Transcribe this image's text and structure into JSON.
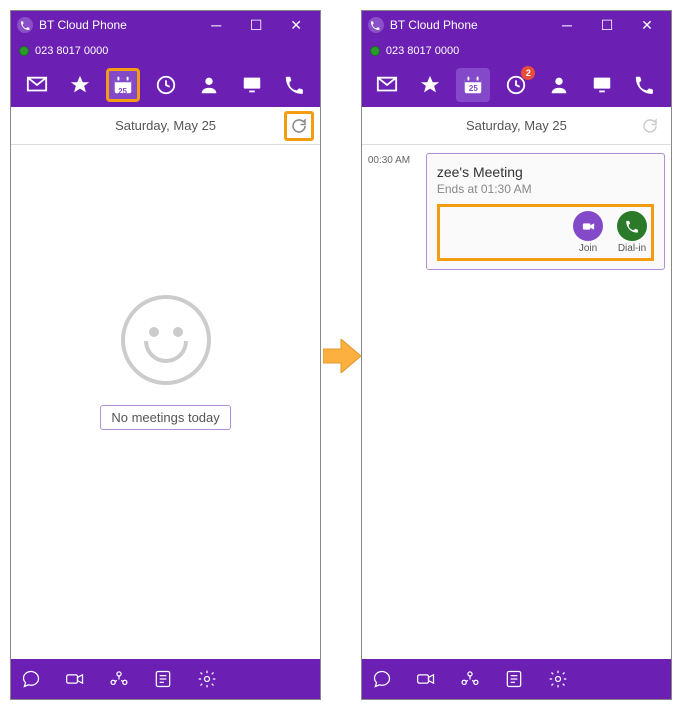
{
  "app_title": "BT Cloud Phone",
  "phone_number": "023 8017 0000",
  "date_header": "Saturday, May 25",
  "calendar_day": "25",
  "notif_count": "2",
  "empty_message": "No meetings today",
  "meeting": {
    "time": "00:30 AM",
    "title": "zee's Meeting",
    "sub": "Ends at 01:30 AM",
    "join_label": "Join",
    "dial_label": "Dial-in"
  }
}
